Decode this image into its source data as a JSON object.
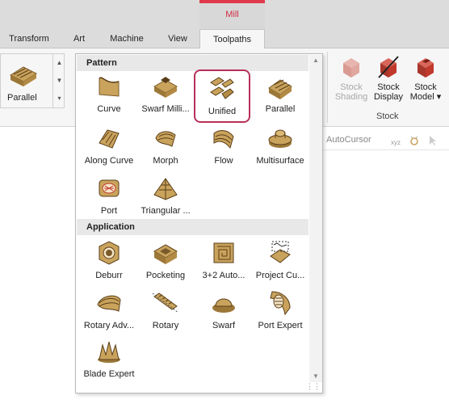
{
  "context_tab": {
    "label": "Mill",
    "color": "#d02e44"
  },
  "tabs": [
    {
      "label": "Transform",
      "active": false
    },
    {
      "label": "Art",
      "active": false
    },
    {
      "label": "Machine",
      "active": false
    },
    {
      "label": "View",
      "active": false
    },
    {
      "label": "Toolpaths",
      "active": true
    }
  ],
  "ribbon": {
    "gallery_selected": "Parallel",
    "stock_buttons": [
      {
        "label_line1": "Stock",
        "label_line2": "Shading",
        "enabled": false,
        "icon": "stock-shading-icon"
      },
      {
        "label_line1": "Stock",
        "label_line2": "Display",
        "enabled": true,
        "icon": "stock-display-icon"
      },
      {
        "label_line1": "Stock",
        "label_line2": "Model ▾",
        "enabled": true,
        "icon": "stock-model-icon"
      }
    ],
    "stock_group_label": "Stock",
    "subtoolbar_text": "AutoCursor"
  },
  "dropdown": {
    "sections": [
      {
        "title": "Pattern"
      },
      {
        "title": "Application"
      }
    ],
    "pattern_items": [
      {
        "label": "Curve",
        "icon": "curve-icon"
      },
      {
        "label": "Swarf Milli...",
        "icon": "swarf-milling-icon"
      },
      {
        "label": "Unified",
        "icon": "unified-icon",
        "selected": true
      },
      {
        "label": "Parallel",
        "icon": "parallel-icon"
      },
      {
        "label": "Along Curve",
        "icon": "along-curve-icon"
      },
      {
        "label": "Morph",
        "icon": "morph-icon"
      },
      {
        "label": "Flow",
        "icon": "flow-icon"
      },
      {
        "label": "Multisurface",
        "icon": "multisurface-icon"
      },
      {
        "label": "Port",
        "icon": "port-icon"
      },
      {
        "label": "Triangular ...",
        "icon": "triangular-icon"
      }
    ],
    "application_items": [
      {
        "label": "Deburr",
        "icon": "deburr-icon"
      },
      {
        "label": "Pocketing",
        "icon": "pocketing-icon"
      },
      {
        "label": "3+2 Auto...",
        "icon": "3plus2-auto-icon"
      },
      {
        "label": "Project Cu...",
        "icon": "project-curve-icon"
      },
      {
        "label": "Rotary Adv...",
        "icon": "rotary-advanced-icon"
      },
      {
        "label": "Rotary",
        "icon": "rotary-icon"
      },
      {
        "label": "Swarf",
        "icon": "swarf-icon"
      },
      {
        "label": "Port Expert",
        "icon": "port-expert-icon"
      },
      {
        "label": "Blade Expert",
        "icon": "blade-expert-icon"
      }
    ]
  },
  "colors": {
    "part_tan": "#c9a35c",
    "part_dark": "#7a5a2a",
    "stock_red": "#c0392b",
    "selection_border": "#b8305a"
  }
}
